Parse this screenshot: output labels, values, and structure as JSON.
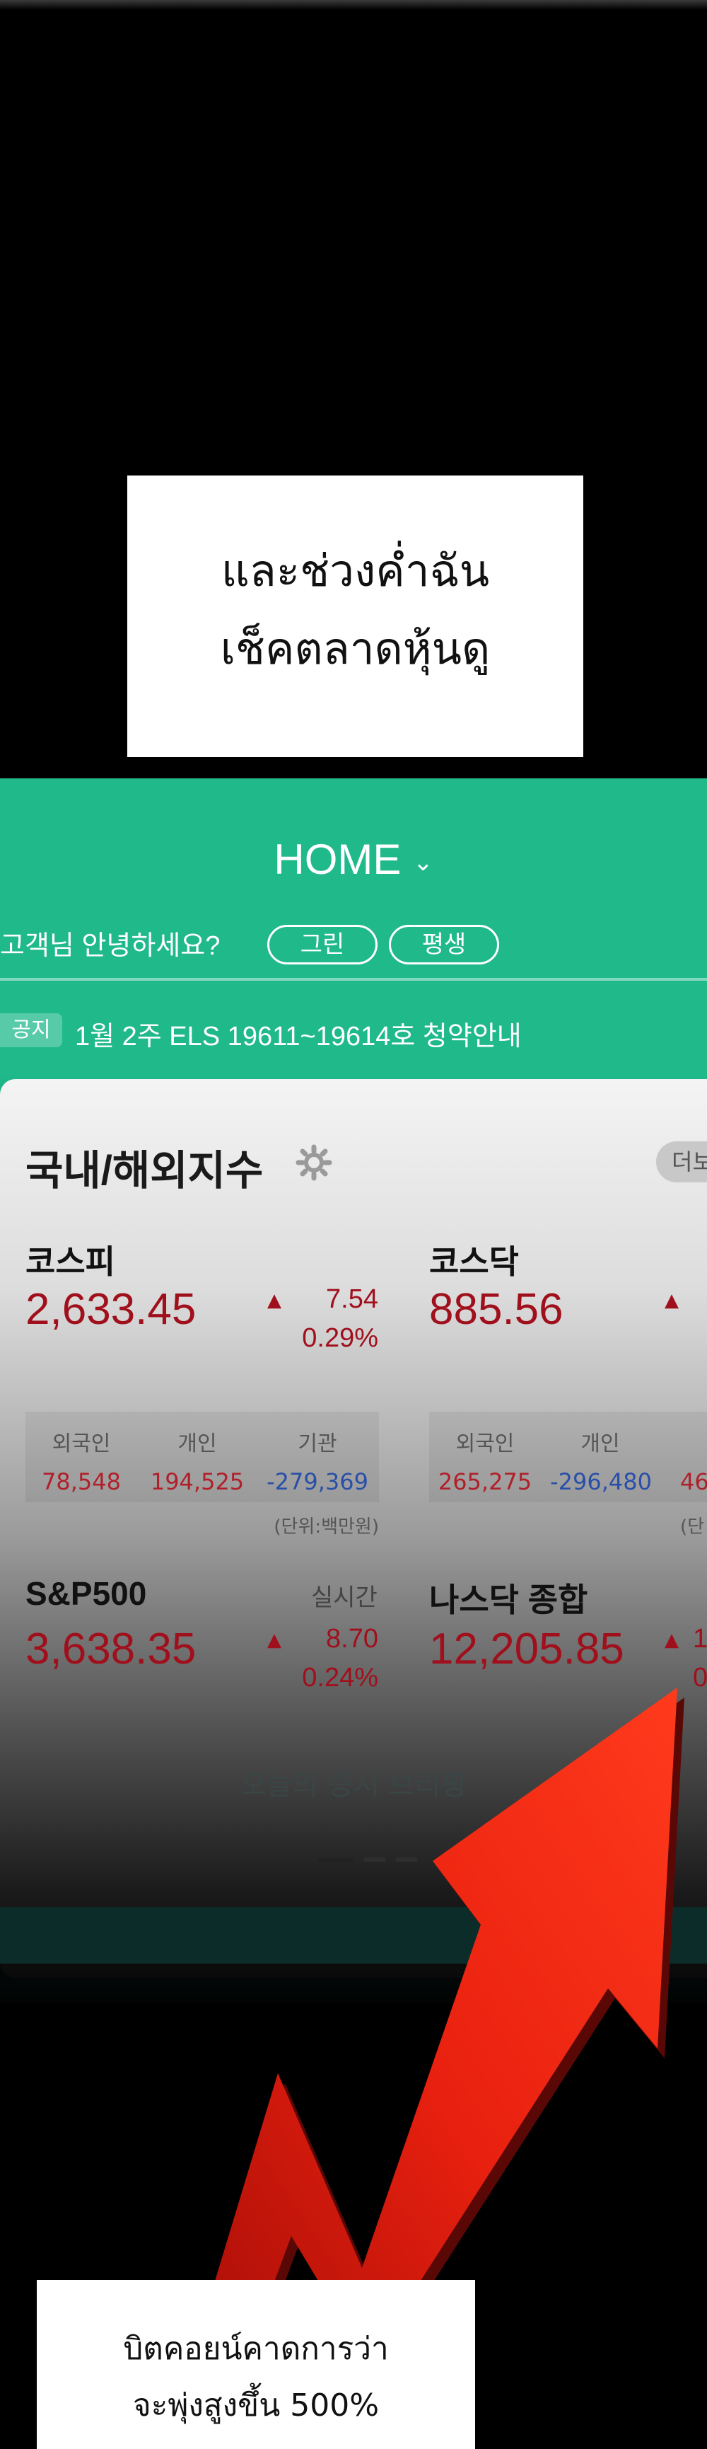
{
  "caption_top": {
    "line1": "และช่วงค่ำฉัน",
    "line2": "เช็คตลาดหุ้นดู"
  },
  "caption_bottom": {
    "line1": "บิตคอยน์คาดการว่า",
    "line2": "จะพุ่งสูงขึ้น 500%"
  },
  "app": {
    "title": "HOME",
    "greeting": "고객님 안녕하세요?",
    "badges": [
      "그린",
      "평생"
    ],
    "notice_tag": "공지",
    "notice_text": "1월 2주 ELS 19611~19614호 청약안내",
    "card_title": "국내/해외지수",
    "more_label": "더보",
    "kospi": {
      "name": "코스피",
      "value": "2,633.45",
      "change": "7.54",
      "percent": "0.29%",
      "flow_headers": [
        "외국인",
        "개인",
        "기관"
      ],
      "flow_values": [
        "78,548",
        "194,525",
        "-279,369"
      ],
      "unit": "(단위:백만원)"
    },
    "kosdaq": {
      "name": "코스닥",
      "value": "885.56",
      "flow_headers": [
        "외국인",
        "개인"
      ],
      "flow_values": [
        "265,275",
        "-296,480",
        "46"
      ],
      "unit": "(단"
    },
    "sp500": {
      "name": "S&P500",
      "realtime": "실시간",
      "value": "3,638.35",
      "change": "8.70",
      "percent": "0.24%"
    },
    "nasdaq": {
      "name": "나스닥 종합",
      "value": "12,205.85",
      "change_partial": "1",
      "percent_partial": "0"
    },
    "briefing": "오늘의 증시 브리핑",
    "bottom_number_partial": "55"
  },
  "colors": {
    "green": "#1fb98a",
    "up_red": "#a0101c",
    "down_blue": "#2a4fa8",
    "arrow": "#e01810"
  }
}
